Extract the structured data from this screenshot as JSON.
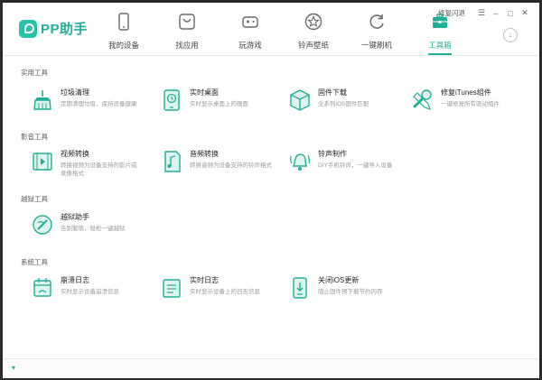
{
  "app": {
    "logo_text": "PP助手",
    "brand_color": "#1fae96"
  },
  "nav": {
    "items": [
      {
        "label": "我的设备",
        "icon": "phone-icon"
      },
      {
        "label": "找应用",
        "icon": "app-store-icon"
      },
      {
        "label": "玩游戏",
        "icon": "gamepad-icon"
      },
      {
        "label": "铃声壁纸",
        "icon": "star-icon"
      },
      {
        "label": "一键刷机",
        "icon": "refresh-icon"
      },
      {
        "label": "工具箱",
        "icon": "toolbox-icon",
        "active": true
      }
    ]
  },
  "top_right": {
    "repair_label": "修复闪退",
    "menu": "☰",
    "minimize": "–",
    "maximize": "□",
    "close": "✕"
  },
  "sections": [
    {
      "title": "实用工具",
      "tools": [
        {
          "name": "垃圾清理",
          "desc": [
            "定期清理垃圾，保持设备健康"
          ],
          "icon": "broom-icon"
        },
        {
          "name": "实时桌面",
          "desc": [
            "实时显示桌面上的画面"
          ],
          "icon": "monitor-icon"
        },
        {
          "name": "固件下载",
          "desc": [
            "全系列iOS固件匹配"
          ],
          "icon": "box-icon"
        },
        {
          "name": "修复iTunes组件",
          "desc": [
            "一键修复所有驱动组件"
          ],
          "icon": "wrench-icon"
        }
      ]
    },
    {
      "title": "影音工具",
      "tools": [
        {
          "name": "视频转换",
          "desc": [
            "转换视频为设备支持的影片或",
            "录像格式"
          ],
          "icon": "film-icon"
        },
        {
          "name": "音频转换",
          "desc": [
            "转换音频为设备支持的铃声格式"
          ],
          "icon": "music-icon"
        },
        {
          "name": "铃声制作",
          "desc": [
            "DIY手机铃声，一键导入设备"
          ],
          "icon": "bell-icon"
        }
      ]
    },
    {
      "title": "越狱工具",
      "tools": [
        {
          "name": "越狱助手",
          "desc": [
            "告别繁琐，轻松一键越狱"
          ],
          "icon": "jailbreak-icon"
        }
      ]
    },
    {
      "title": "系统工具",
      "tools": [
        {
          "name": "崩溃日志",
          "desc": [
            "实时显示设备崩溃信息"
          ],
          "icon": "calendar-icon"
        },
        {
          "name": "实时日志",
          "desc": [
            "实时显示设备上的日志信息"
          ],
          "icon": "log-icon"
        },
        {
          "name": "关闭iOS更新",
          "desc": [
            "阻止固件预下载节约内存"
          ],
          "icon": "block-update-icon"
        }
      ]
    }
  ]
}
